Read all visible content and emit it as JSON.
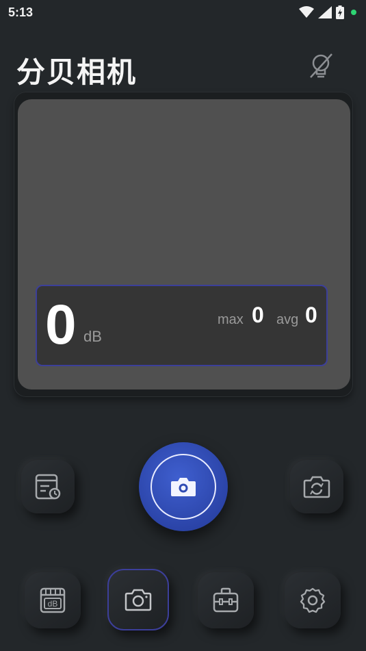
{
  "status_bar": {
    "time": "5:13",
    "icons": [
      "wifi-icon",
      "signal-icon",
      "battery-charging-icon"
    ],
    "dot_color": "#2ed573"
  },
  "header": {
    "title": "分贝相机",
    "flash_icon": "flash-off-icon"
  },
  "meter": {
    "value": "0",
    "unit": "dB",
    "max_label": "max",
    "max_value": "0",
    "avg_label": "avg",
    "avg_value": "0",
    "accent": "#3c3f9a"
  },
  "controls": {
    "left_icon": "history-icon",
    "shutter_icon": "camera-icon",
    "right_icon": "switch-camera-icon",
    "shutter_color": "#2b44a8"
  },
  "bottom_nav": {
    "items": [
      {
        "icon": "decibel-meter-icon",
        "active": false
      },
      {
        "icon": "camera-icon",
        "active": true
      },
      {
        "icon": "toolbox-icon",
        "active": false
      },
      {
        "icon": "settings-icon",
        "active": false
      }
    ]
  }
}
